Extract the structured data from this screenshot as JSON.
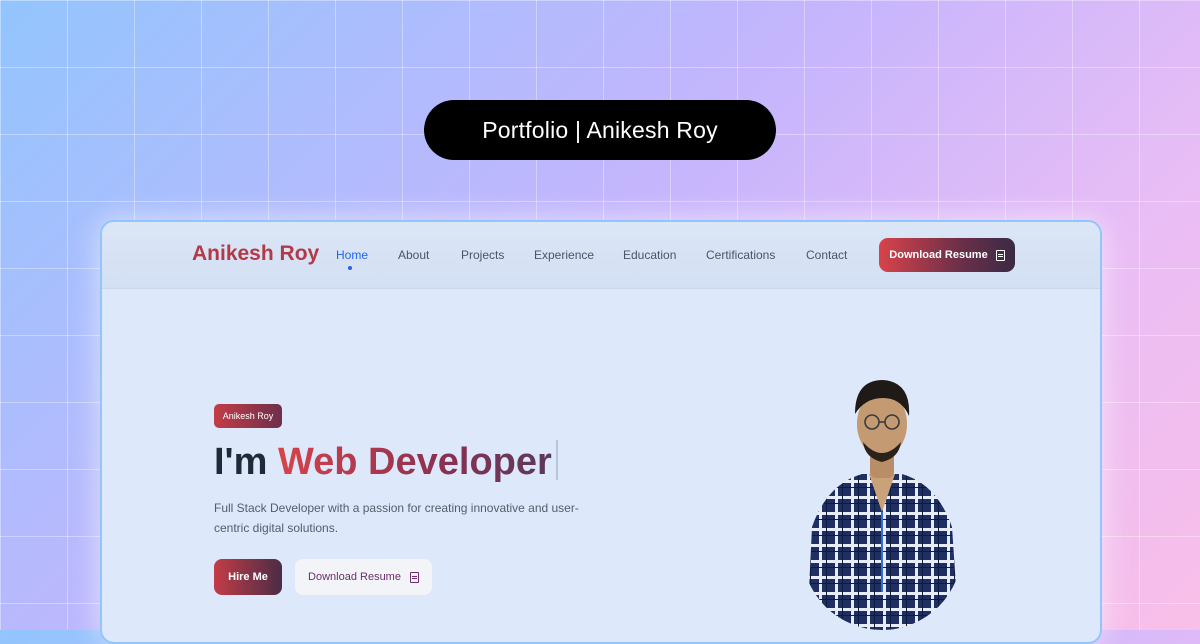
{
  "overlay": {
    "title": "Portfolio | Anikesh Roy"
  },
  "nav": {
    "brand": "Anikesh Roy",
    "links": [
      "Home",
      "About",
      "Projects",
      "Experience",
      "Education",
      "Certifications",
      "Contact"
    ],
    "active": "Home",
    "resume_label": "Download Resume"
  },
  "hero": {
    "badge": "Anikesh Roy",
    "headline_prefix": "I'm",
    "headline_accent": "Web Developer",
    "description": "Full Stack Developer with a passion for creating innovative and user-centric digital solutions.",
    "hire_label": "Hire Me",
    "resume_label": "Download Resume"
  },
  "colors": {
    "accent_red": "#d7434a",
    "accent_plum": "#4a2c45",
    "active_link": "#2563eb",
    "frame_border": "#93c5fd"
  },
  "icons": {
    "resume": "document-icon"
  }
}
